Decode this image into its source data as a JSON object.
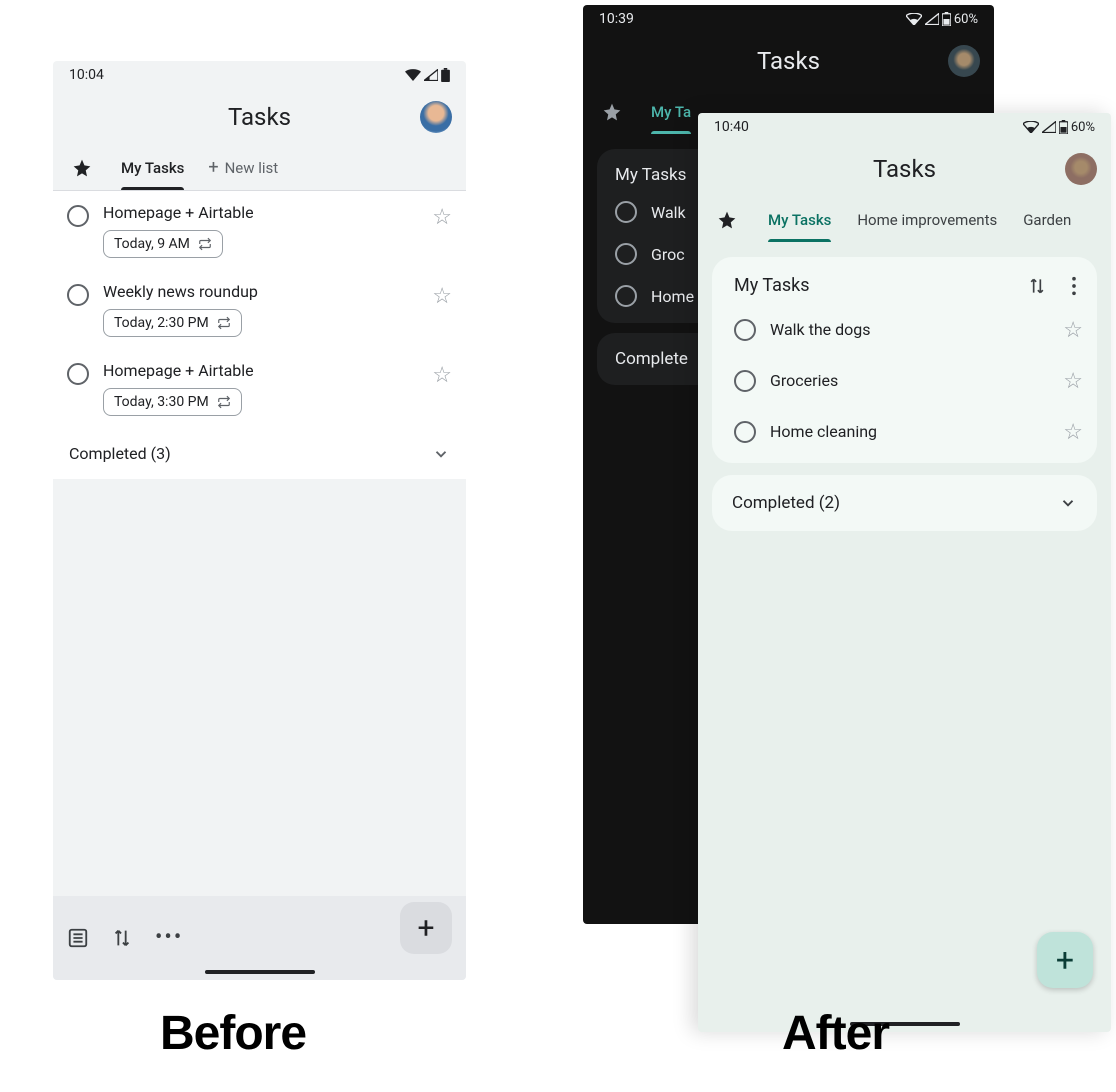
{
  "captions": {
    "before": "Before",
    "after": "After"
  },
  "before": {
    "status_time": "10:04",
    "status_battery": "",
    "app_title": "Tasks",
    "tabs": {
      "active": "My Tasks",
      "new_list": "New list"
    },
    "tasks": [
      {
        "title": "Homepage + Airtable",
        "chip": "Today, 9 AM"
      },
      {
        "title": "Weekly news roundup",
        "chip": "Today, 2:30 PM"
      },
      {
        "title": "Homepage + Airtable",
        "chip": "Today, 3:30 PM"
      }
    ],
    "completed_label": "Completed (3)"
  },
  "dark": {
    "status_time": "10:39",
    "status_battery": "60%",
    "app_title": "Tasks",
    "tabs": {
      "active": "My Ta"
    },
    "card_title": "My Tasks",
    "tasks": [
      {
        "title": "Walk"
      },
      {
        "title": "Groc"
      },
      {
        "title": "Home"
      }
    ],
    "completed_label": "Complete"
  },
  "after": {
    "status_time": "10:40",
    "status_battery": "60%",
    "app_title": "Tasks",
    "tabs": {
      "active": "My Tasks",
      "others": [
        "Home improvements",
        "Garden"
      ]
    },
    "card_title": "My Tasks",
    "tasks": [
      {
        "title": "Walk the dogs"
      },
      {
        "title": "Groceries"
      },
      {
        "title": "Home cleaning"
      }
    ],
    "completed_label": "Completed (2)"
  }
}
